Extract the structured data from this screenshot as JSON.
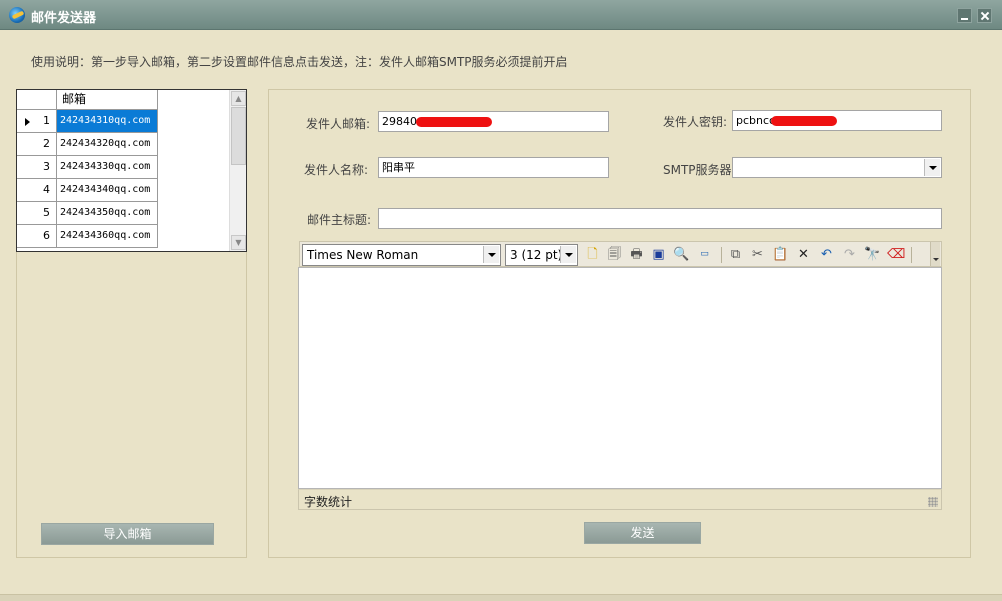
{
  "window": {
    "title": "邮件发送器"
  },
  "instruction": "使用说明：第一步导入邮箱，第二步设置邮件信息点击发送，注：发件人邮箱SMTP服务必须提前开启",
  "grid": {
    "column_header": "邮箱",
    "rows": [
      {
        "index": "1",
        "email": "242434310qq.com"
      },
      {
        "index": "2",
        "email": "242434320qq.com"
      },
      {
        "index": "3",
        "email": "242434330qq.com"
      },
      {
        "index": "4",
        "email": "242434340qq.com"
      },
      {
        "index": "5",
        "email": "242434350qq.com"
      },
      {
        "index": "6",
        "email": "242434360qq.com"
      }
    ],
    "selected_row": 1
  },
  "buttons": {
    "import": "导入邮箱",
    "send": "发送"
  },
  "form": {
    "sender_email_label": "发件人邮箱:",
    "sender_email_value": "29840",
    "sender_password_label": "发件人密钥:",
    "sender_password_value": "pcbncc",
    "sender_name_label": "发件人名称:",
    "sender_name_value": "阳串平",
    "smtp_label": "SMTP服务器:",
    "smtp_value": "",
    "subject_label": "邮件主标题:",
    "subject_value": ""
  },
  "editor": {
    "font_name": "Times New Roman",
    "font_size": "3 (12 pt)",
    "word_count_label": "字数统计"
  },
  "colors": {
    "titlebar": "#7b938d",
    "background": "#e9e3c8",
    "selected": "#0a7bd6",
    "redaction": "#ee1111"
  }
}
